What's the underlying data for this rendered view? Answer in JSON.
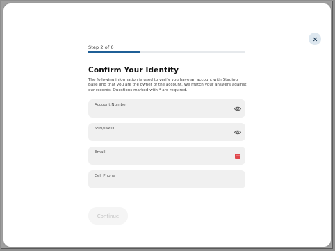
{
  "wizard": {
    "step_text": "Step 2 of 6",
    "progress": 0.333
  },
  "heading": {
    "title": "Confirm Your Identity",
    "description": "The following information is used to verify you have an account with Staging Base and that you are the owner of the account. We match your answers against our records. Questions marked with * are required."
  },
  "form": {
    "account_number": {
      "label": "Account Number",
      "value": "",
      "icon": "eye-icon"
    },
    "ssn_taxid": {
      "label": "SSN/TaxID",
      "value": "",
      "icon": "eye-icon"
    },
    "email": {
      "label": "Email",
      "value": "",
      "icon": "autofill-icon"
    },
    "cell_phone": {
      "label": "Cell Phone",
      "value": ""
    }
  },
  "actions": {
    "continue_label": "Continue",
    "close_icon": "close-icon"
  },
  "colors": {
    "progress_fill": "#1f5f96",
    "field_bg": "#f0f0f0",
    "autofill_icon": "#e0474c"
  }
}
